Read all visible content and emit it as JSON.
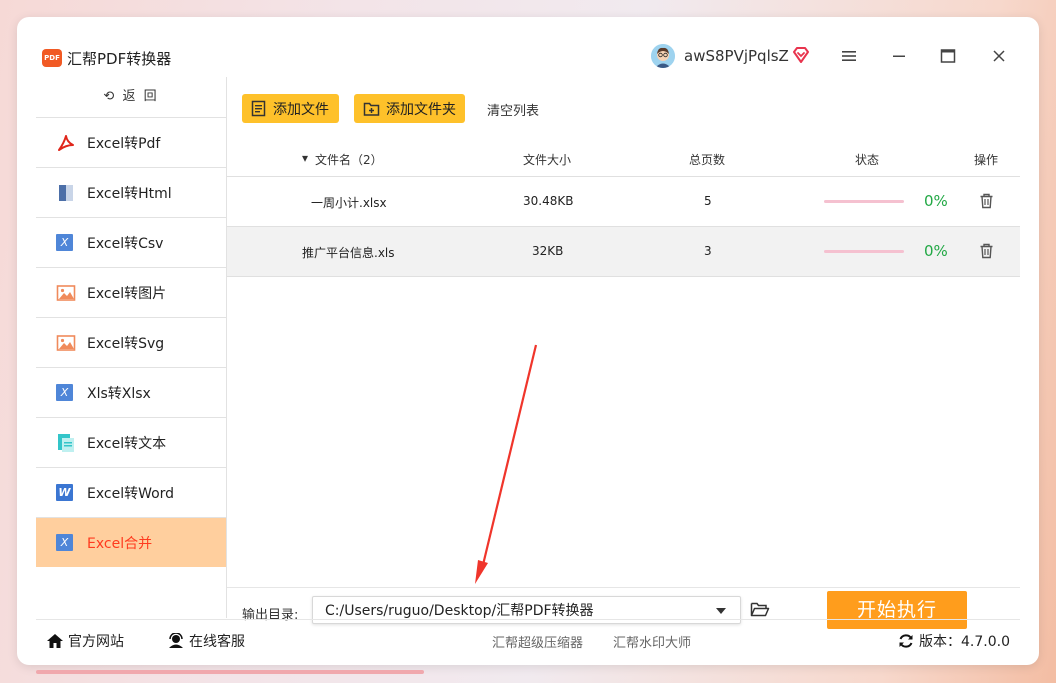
{
  "app": {
    "logo_text": "PDF",
    "title": "汇帮PDF转换器",
    "username": "awS8PVjPqlsZ"
  },
  "sidebar": {
    "back_label": "返 回",
    "items": [
      {
        "label": "Excel转Pdf",
        "icon": "pdf-icon"
      },
      {
        "label": "Excel转Html",
        "icon": "html-icon"
      },
      {
        "label": "Excel转Csv",
        "icon": "excel-x-icon"
      },
      {
        "label": "Excel转图片",
        "icon": "image-icon"
      },
      {
        "label": "Excel转Svg",
        "icon": "image-icon"
      },
      {
        "label": "Xls转Xlsx",
        "icon": "excel-x-icon"
      },
      {
        "label": "Excel转文本",
        "icon": "text-doc-icon"
      },
      {
        "label": "Excel转Word",
        "icon": "word-icon"
      },
      {
        "label": "Excel合并",
        "icon": "excel-x-icon",
        "active": true
      }
    ]
  },
  "toolbar": {
    "add_file": "添加文件",
    "add_folder": "添加文件夹",
    "clear_list": "清空列表"
  },
  "table": {
    "headers": {
      "name": "文件名（2）",
      "size": "文件大小",
      "pages": "总页数",
      "status": "状态",
      "action": "操作"
    },
    "rows": [
      {
        "name": "一周小计.xlsx",
        "size": "30.48KB",
        "pages": "5",
        "progress": 0,
        "percent": "0%"
      },
      {
        "name": "推广平台信息.xls",
        "size": "32KB",
        "pages": "3",
        "progress": 0,
        "percent": "0%"
      }
    ]
  },
  "output": {
    "label": "输出目录:",
    "path": "C:/Users/ruguo/Desktop/汇帮PDF转换器",
    "start_button": "开始执行"
  },
  "footer": {
    "website": "官方网站",
    "support": "在线客服",
    "link1": "汇帮超级压缩器",
    "link2": "汇帮水印大师",
    "version": "版本：4.7.0.0"
  },
  "colors": {
    "accent": "#fec12a",
    "start": "#ff9d1c",
    "active_bg": "#ffcf9e",
    "active_text": "#ff3b1f",
    "percent": "#22a845"
  }
}
